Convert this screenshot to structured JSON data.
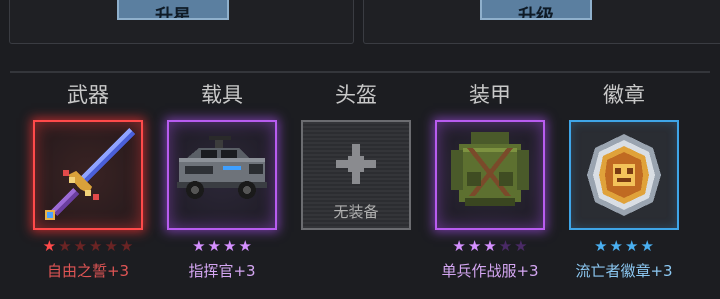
{
  "top": {
    "left_button_label": "升星",
    "right_button_label": "升级"
  },
  "colors": {
    "red": "#ff4a4a",
    "purple": "#b85cf0",
    "blue": "#3fa6e8",
    "star_empty": "#6a2424",
    "star_empty_purple": "#4a2a66"
  },
  "slots": [
    {
      "title": "武器",
      "item": "自由之誓+3",
      "rarity": "red",
      "stars_filled": 1,
      "stars_total": 6,
      "icon": "sword-icon",
      "name_color": "#e05555"
    },
    {
      "title": "载具",
      "item": "指挥官+3",
      "rarity": "purple",
      "stars_filled": 4,
      "stars_total": 4,
      "icon": "armored-car-icon",
      "name_color": "#d4a6f2"
    },
    {
      "title": "头盔",
      "item": "",
      "empty_label": "无装备",
      "rarity": "gray",
      "stars_filled": 0,
      "stars_total": 0,
      "icon": "plus-icon"
    },
    {
      "title": "装甲",
      "item": "单兵作战服+3",
      "rarity": "purple",
      "stars_filled": 3,
      "stars_total": 5,
      "icon": "armor-vest-icon",
      "name_color": "#d4a6f2"
    },
    {
      "title": "徽章",
      "item": "流亡者徽章+3",
      "rarity": "blue",
      "stars_filled": 4,
      "stars_total": 4,
      "icon": "badge-icon",
      "name_color": "#8cc8f2"
    }
  ]
}
